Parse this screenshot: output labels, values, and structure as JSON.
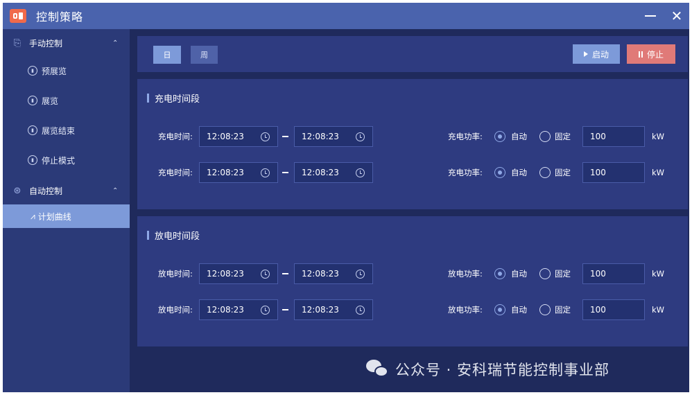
{
  "window": {
    "title": "控制策略",
    "minimize_glyph": "—",
    "close_glyph": "✕"
  },
  "sidebar": {
    "groups": [
      {
        "label": "手动控制",
        "icon": "manual-control-icon",
        "expanded": true,
        "items": [
          {
            "label": "预展览",
            "icon": "circle-icon"
          },
          {
            "label": "展览",
            "icon": "circle-icon"
          },
          {
            "label": "展览结束",
            "icon": "circle-icon"
          },
          {
            "label": "停止模式",
            "icon": "circle-icon"
          }
        ]
      },
      {
        "label": "自动控制",
        "icon": "auto-control-icon",
        "expanded": true,
        "items": [
          {
            "label": "计划曲线",
            "icon": "line-chart-icon",
            "active": true
          }
        ]
      }
    ]
  },
  "toolbar": {
    "tab_day": "日",
    "tab_week": "周",
    "active_tab": "日",
    "start_label": "启动",
    "stop_label": "停止"
  },
  "charge": {
    "title": "充电时间段",
    "rows": [
      {
        "time_label": "充电时间:",
        "start": "12:08:23",
        "end": "12:08:23",
        "power_label": "充电功率:",
        "auto_label": "自动",
        "fixed_label": "固定",
        "mode": "自动",
        "value": "100",
        "unit": "kW"
      },
      {
        "time_label": "充电时间:",
        "start": "12:08:23",
        "end": "12:08:23",
        "power_label": "充电功率:",
        "auto_label": "自动",
        "fixed_label": "固定",
        "mode": "自动",
        "value": "100",
        "unit": "kW"
      }
    ]
  },
  "discharge": {
    "title": "放电时间段",
    "rows": [
      {
        "time_label": "放电时间:",
        "start": "12:08:23",
        "end": "12:08:23",
        "power_label": "放电功率:",
        "auto_label": "自动",
        "fixed_label": "固定",
        "mode": "自动",
        "value": "100",
        "unit": "kW"
      },
      {
        "time_label": "放电时间:",
        "start": "12:08:23",
        "end": "12:08:23",
        "power_label": "放电功率:",
        "auto_label": "自动",
        "fixed_label": "固定",
        "mode": "自动",
        "value": "100",
        "unit": "kW"
      }
    ]
  },
  "watermark": {
    "text": "公众号 · 安科瑞节能控制事业部"
  },
  "colors": {
    "titlebar": "#4a63ad",
    "sidebar": "#2b3a78",
    "panel": "#2e3b80",
    "accent": "#7d9ad9",
    "stop": "#e07a78"
  }
}
